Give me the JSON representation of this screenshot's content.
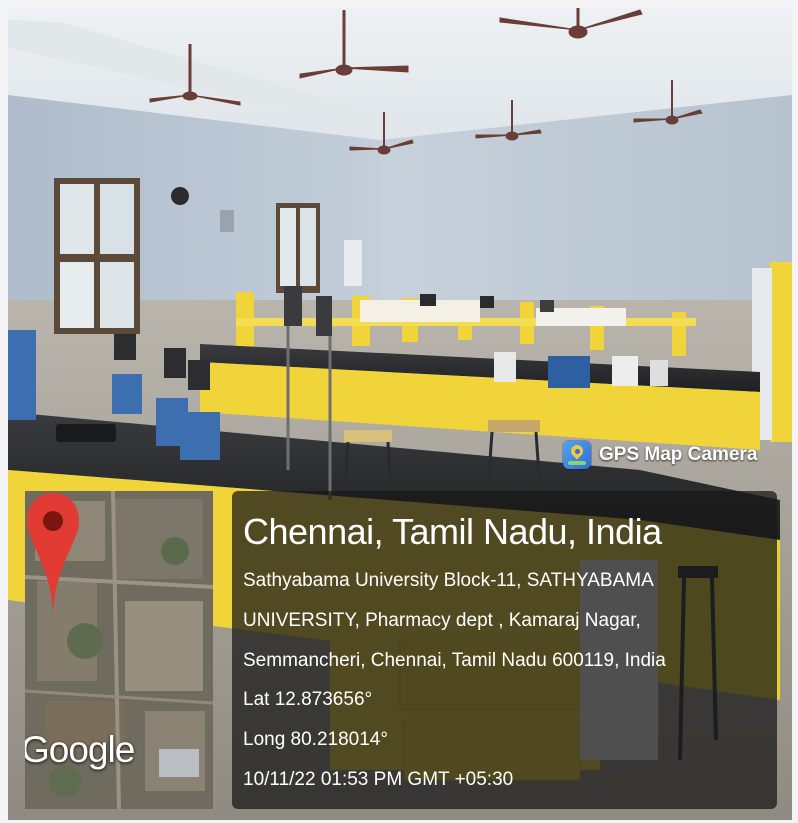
{
  "badge": {
    "text": "GPS Map Camera",
    "icon": "gps-map-camera-icon"
  },
  "map": {
    "logo": "Google",
    "marker_icon": "map-pin-icon",
    "marker_color": "#e23b33"
  },
  "location": {
    "title": "Chennai, Tamil Nadu, India",
    "address_lines": [
      "Sathyabama University Block-11, SATHYABAMA",
      "UNIVERSITY, Pharmacy dept , Kamaraj Nagar,",
      "Semmancheri, Chennai, Tamil Nadu 600119, India"
    ],
    "lat": "Lat 12.873656°",
    "long": "Long 80.218014°",
    "timestamp": "10/11/22 01:53 PM GMT +05:30"
  },
  "colors": {
    "bench_yellow": "#f0d43a",
    "worktop": "#2c2c2e",
    "wall": "#b9c6d3",
    "ceiling": "#e9edf0",
    "panel": "#181818"
  }
}
